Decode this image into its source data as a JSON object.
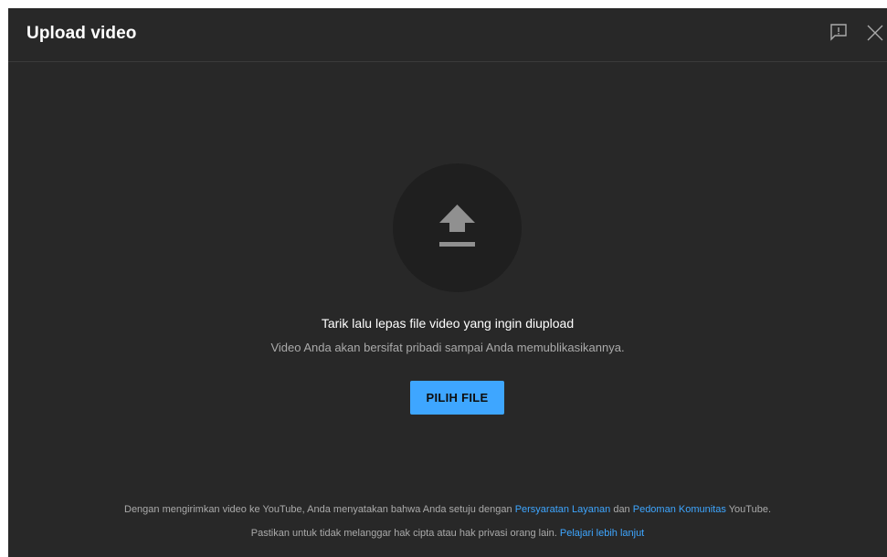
{
  "dialog": {
    "title": "Upload video",
    "feedback_icon": "feedback-icon",
    "close_icon": "close-icon"
  },
  "upload": {
    "icon": "upload-icon",
    "main_text": "Tarik lalu lepas file video yang ingin diupload",
    "sub_text": "Video Anda akan bersifat pribadi sampai Anda memublikasikannya.",
    "button_label": "PILIH FILE"
  },
  "footer": {
    "line1_prefix": "Dengan mengirimkan video ke YouTube, Anda menyatakan bahwa Anda setuju dengan ",
    "terms_link": "Persyaratan Layanan",
    "line1_middle": " dan ",
    "guidelines_link": "Pedoman Komunitas",
    "line1_suffix": " YouTube.",
    "line2_prefix": "Pastikan untuk tidak melanggar hak cipta atau hak privasi orang lain. ",
    "learn_more_link": "Pelajari lebih lanjut"
  },
  "colors": {
    "dialog_bg": "#282828",
    "accent": "#3ea6ff",
    "circle_bg": "#1f1f1f",
    "secondary_text": "#aaaaaa"
  }
}
